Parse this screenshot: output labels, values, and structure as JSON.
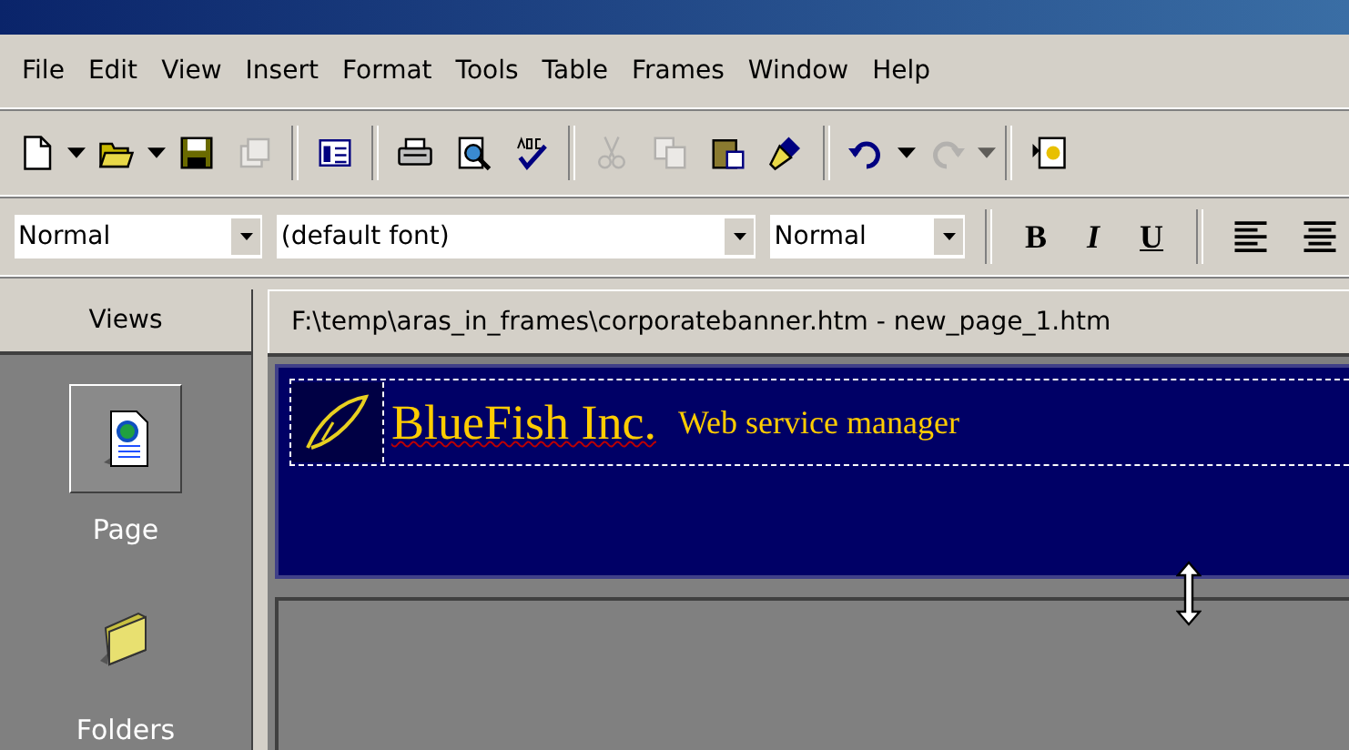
{
  "menu": [
    {
      "label": "File"
    },
    {
      "label": "Edit"
    },
    {
      "label": "View"
    },
    {
      "label": "Insert"
    },
    {
      "label": "Format"
    },
    {
      "label": "Tools"
    },
    {
      "label": "Table"
    },
    {
      "label": "Frames"
    },
    {
      "label": "Window"
    },
    {
      "label": "Help"
    }
  ],
  "toolbar": [
    {
      "kind": "new",
      "disabled": false
    },
    {
      "kind": "drop",
      "disabled": false
    },
    {
      "kind": "open",
      "disabled": false
    },
    {
      "kind": "drop",
      "disabled": false
    },
    {
      "kind": "save",
      "disabled": false
    },
    {
      "kind": "publish",
      "disabled": true
    },
    {
      "kind": "sep"
    },
    {
      "kind": "folderlist",
      "disabled": false
    },
    {
      "kind": "sep"
    },
    {
      "kind": "print",
      "disabled": false
    },
    {
      "kind": "preview",
      "disabled": false
    },
    {
      "kind": "spell",
      "disabled": false
    },
    {
      "kind": "sep"
    },
    {
      "kind": "cut",
      "disabled": true
    },
    {
      "kind": "copy",
      "disabled": true
    },
    {
      "kind": "paste",
      "disabled": false
    },
    {
      "kind": "painter",
      "disabled": false
    },
    {
      "kind": "sep"
    },
    {
      "kind": "undo",
      "disabled": false
    },
    {
      "kind": "drop",
      "disabled": false
    },
    {
      "kind": "redo",
      "disabled": true
    },
    {
      "kind": "drop",
      "disabled": true
    },
    {
      "kind": "sep"
    },
    {
      "kind": "web",
      "disabled": false
    }
  ],
  "format_bar": {
    "style": "Normal",
    "font": "(default font)",
    "size": "Normal",
    "bold": "B",
    "italic": "I",
    "underline": "U"
  },
  "views": {
    "header": "Views",
    "items": [
      {
        "label": "Page",
        "kind": "page",
        "selected": true
      },
      {
        "label": "Folders",
        "kind": "folder",
        "selected": false
      }
    ]
  },
  "document": {
    "tab": "F:\\temp\\aras_in_frames\\corporatebanner.htm - new_page_1.htm",
    "banner": {
      "company": "BlueFish Inc.",
      "tagline": "Web service manager"
    }
  }
}
